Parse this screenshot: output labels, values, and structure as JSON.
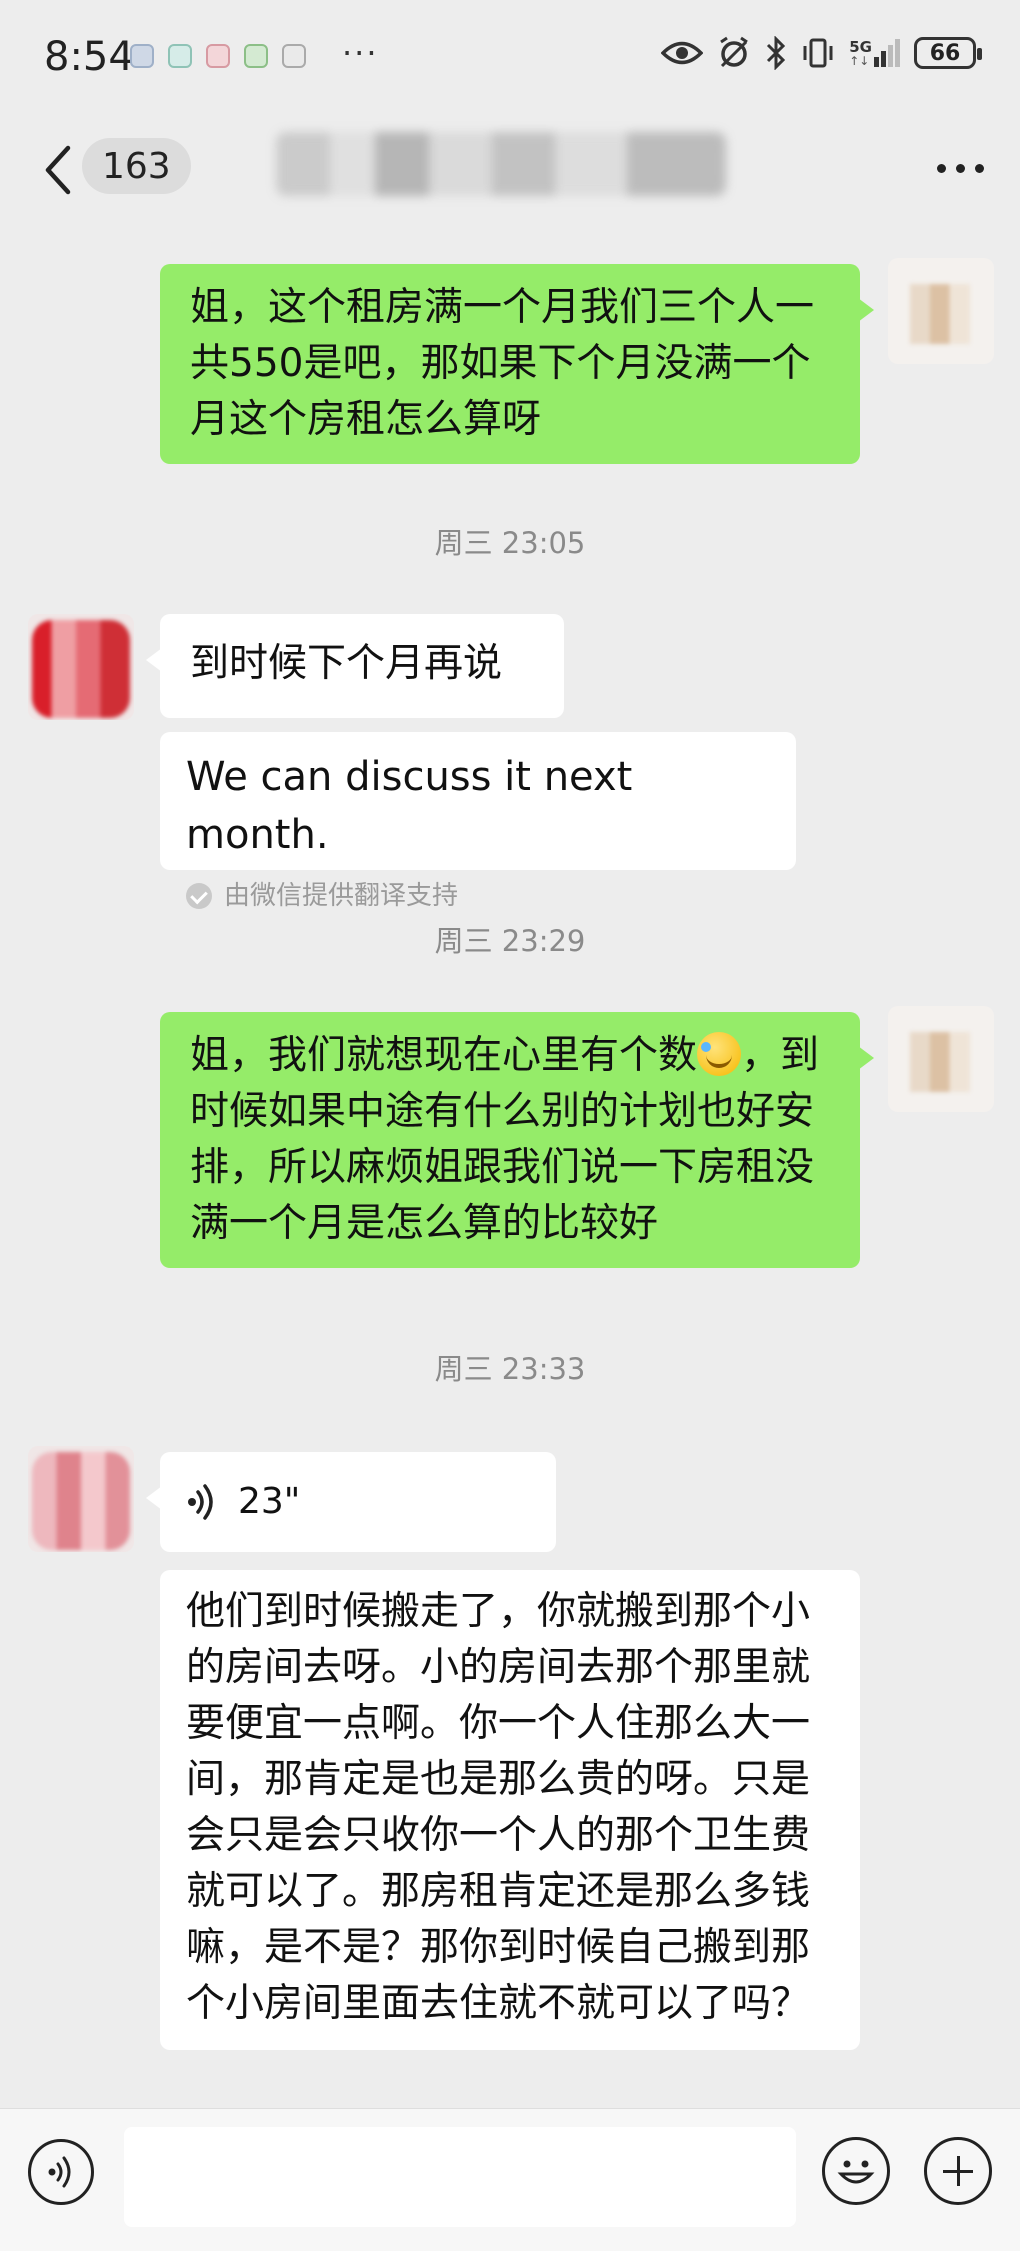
{
  "status_bar": {
    "time": "8:54",
    "more": "···",
    "network_label": "5G",
    "battery": "66",
    "notification_app_icons": [
      "app-icon-1",
      "app-icon-2",
      "app-icon-3",
      "app-icon-4",
      "app-icon-5"
    ]
  },
  "nav": {
    "back_icon": "chevron-left-icon",
    "unread_count": "163",
    "more_icon": "more-dots-icon"
  },
  "messages": [
    {
      "kind": "sent",
      "text": "姐，这个租房满一个月我们三个人一共550是吧，那如果下个月没满一个月这个房租怎么算呀"
    },
    {
      "kind": "timestamp",
      "text": "周三 23:05"
    },
    {
      "kind": "received",
      "text": "到时候下个月再说"
    },
    {
      "kind": "translation",
      "text": "We can discuss it next month.",
      "note": "由微信提供翻译支持"
    },
    {
      "kind": "timestamp",
      "text": "周三 23:29"
    },
    {
      "kind": "sent",
      "text_before_emoji": "姐，我们就想现在心里有个数",
      "text_after_emoji": "，到时候如果中途有什么别的计划也好安排，所以麻烦姐跟我们说一下房租没满一个月是怎么算的比较好"
    },
    {
      "kind": "timestamp",
      "text": "周三 23:33"
    },
    {
      "kind": "voice",
      "duration": "23\""
    },
    {
      "kind": "transcript",
      "text": "他们到时候搬走了，你就搬到那个小的房间去呀。小的房间去那个那里就要便宜一点啊。你一个人住那么大一间，那肯定是也是那么贵的呀。只是会只是会只收你一个人的那个卫生费就可以了。那房租肯定还是那么多钱嘛，是不是？那你到时候自己搬到那个小房间里面去住就不就可以了吗？"
    }
  ],
  "input_bar": {
    "voice_icon": "voice-input-icon",
    "emoji_icon": "emoji-icon",
    "plus_icon": "plus-icon"
  }
}
